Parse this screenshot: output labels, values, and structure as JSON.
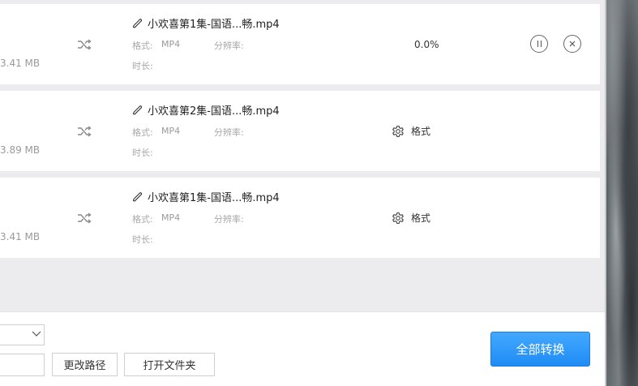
{
  "items": [
    {
      "size": "3.41 MB",
      "name": "小欢喜第1集-国语...畅.mp4",
      "format_label": "格式:",
      "format_value": "MP4",
      "resolution_label": "分辨率:",
      "duration_label": "时长:",
      "progress": "0.0%"
    },
    {
      "size": "3.89 MB",
      "name": "小欢喜第2集-国语...畅.mp4",
      "format_label": "格式:",
      "format_value": "MP4",
      "resolution_label": "分辨率:",
      "duration_label": "时长:",
      "format_button": "格式"
    },
    {
      "size": "3.41 MB",
      "name": "小欢喜第1集-国语...畅.mp4",
      "format_label": "格式:",
      "format_value": "MP4",
      "resolution_label": "分辨率:",
      "duration_label": "时长:",
      "format_button": "格式"
    }
  ],
  "bottom": {
    "change_path": "更改路径",
    "open_folder": "打开文件夹",
    "convert_all": "全部转换"
  },
  "icons": {
    "shuffle": "shuffle-icon",
    "pencil": "pencil-icon",
    "gear": "gear-icon",
    "pause": "pause-icon",
    "close": "close-icon",
    "chevron": "chevron-down-icon"
  },
  "colors": {
    "accent": "#1f8cf5",
    "list_bg": "#ececee"
  }
}
